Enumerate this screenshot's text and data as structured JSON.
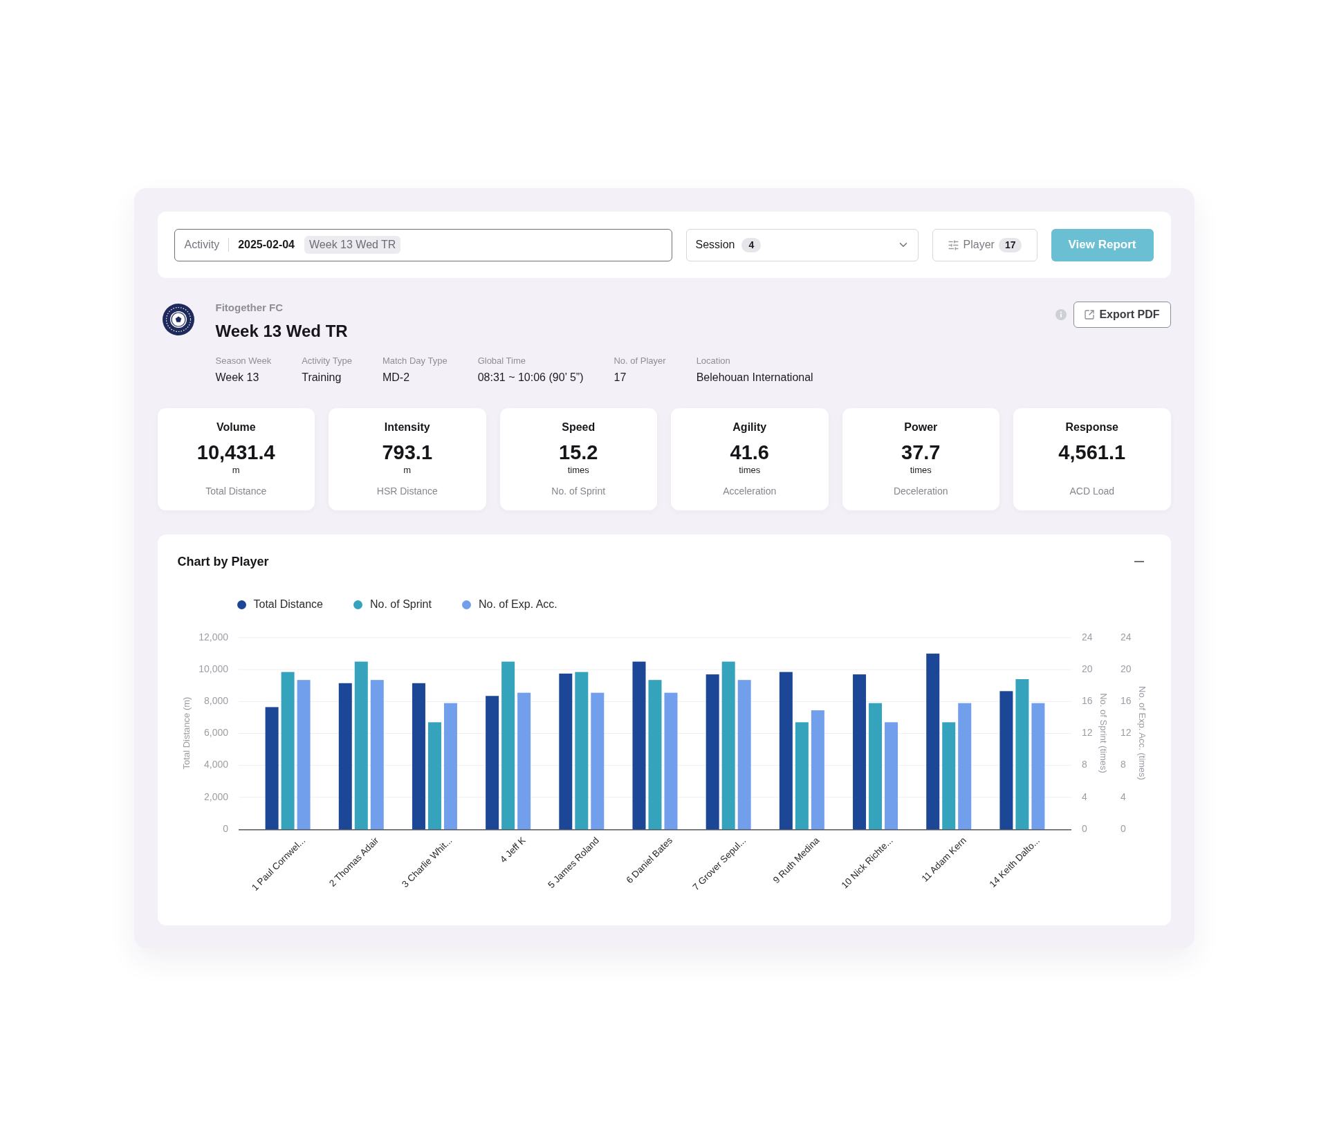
{
  "filter_bar": {
    "activity": {
      "label": "Activity",
      "date": "2025-02-04",
      "chip": "Week 13 Wed TR"
    },
    "session": {
      "label": "Session",
      "count": "4"
    },
    "player_filter": {
      "label": "Player",
      "count": "17"
    },
    "view_report": "View Report"
  },
  "header": {
    "club": "Fitogether FC",
    "title": "Week 13 Wed TR",
    "export_label": "Export PDF",
    "details": [
      {
        "label": "Season Week",
        "value": "Week 13"
      },
      {
        "label": "Activity Type",
        "value": "Training"
      },
      {
        "label": "Match Day Type",
        "value": "MD-2"
      },
      {
        "label": "Global Time",
        "value": "08:31 ~ 10:06 (90’ 5”)"
      },
      {
        "label": "No. of Player",
        "value": "17"
      },
      {
        "label": "Location",
        "value": "Belehouan International"
      }
    ]
  },
  "metrics": [
    {
      "title": "Volume",
      "value": "10,431.4",
      "unit": "m",
      "caption": "Total Distance"
    },
    {
      "title": "Intensity",
      "value": "793.1",
      "unit": "m",
      "caption": "HSR Distance"
    },
    {
      "title": "Speed",
      "value": "15.2",
      "unit": "times",
      "caption": "No. of Sprint"
    },
    {
      "title": "Agility",
      "value": "41.6",
      "unit": "times",
      "caption": "Acceleration"
    },
    {
      "title": "Power",
      "value": "37.7",
      "unit": "times",
      "caption": "Deceleration"
    },
    {
      "title": "Response",
      "value": "4,561.1",
      "caption": "ACD Load"
    }
  ],
  "chart_panel": {
    "title": "Chart by Player",
    "chart_data": {
      "type": "bar",
      "grid": true,
      "categories": [
        "1 Paul Cornwel...",
        "2 Thomas Adair",
        "3 Charlie Whit...",
        "4 Jeff K",
        "5 James Roland",
        "6 Daniel Bates",
        "7 Grover Sepul...",
        "9 Ruth Medina",
        "10 Nick Richte...",
        "11 Adam Kern",
        "14 Keith Dalto..."
      ],
      "ylabel": "Total Distance (m)",
      "ylim": [
        0,
        12000
      ],
      "yticks": [
        0,
        {
          "value": 2000,
          "label": "2,000"
        },
        {
          "value": 4000,
          "label": "4,000"
        },
        {
          "value": 6000,
          "label": "6,000"
        },
        {
          "value": 8000,
          "label": "8,000"
        },
        {
          "value": 10000,
          "label": "10,000"
        },
        {
          "value": 12000,
          "label": "12,000"
        }
      ],
      "y2label": "No. of Sprint (times)",
      "y2lim": [
        0,
        24
      ],
      "y2ticks": [
        0,
        4,
        8,
        12,
        16,
        20,
        24
      ],
      "y3label": "No. of Exp. Acc. (times)",
      "y3lim": [
        0,
        24
      ],
      "y3ticks": [
        0,
        4,
        8,
        12,
        16,
        20,
        24
      ],
      "series": [
        {
          "name": "Total Distance",
          "color": "#1c4796",
          "axis": "y",
          "values": [
            7650,
            9150,
            9150,
            8350,
            9750,
            10500,
            9700,
            9850,
            9700,
            11000,
            8650
          ]
        },
        {
          "name": "No. of Sprint",
          "color": "#36a3bd",
          "axis": "y2",
          "values": [
            19.7,
            21,
            13.4,
            21,
            19.7,
            18.7,
            21,
            13.4,
            15.8,
            13.4,
            18.8
          ]
        },
        {
          "name": "No. of Exp. Acc.",
          "color": "#729fec",
          "axis": "y3",
          "values": [
            18.7,
            18.7,
            15.8,
            17.1,
            17.1,
            17.1,
            18.7,
            14.9,
            13.4,
            15.8,
            15.8
          ]
        }
      ]
    }
  }
}
